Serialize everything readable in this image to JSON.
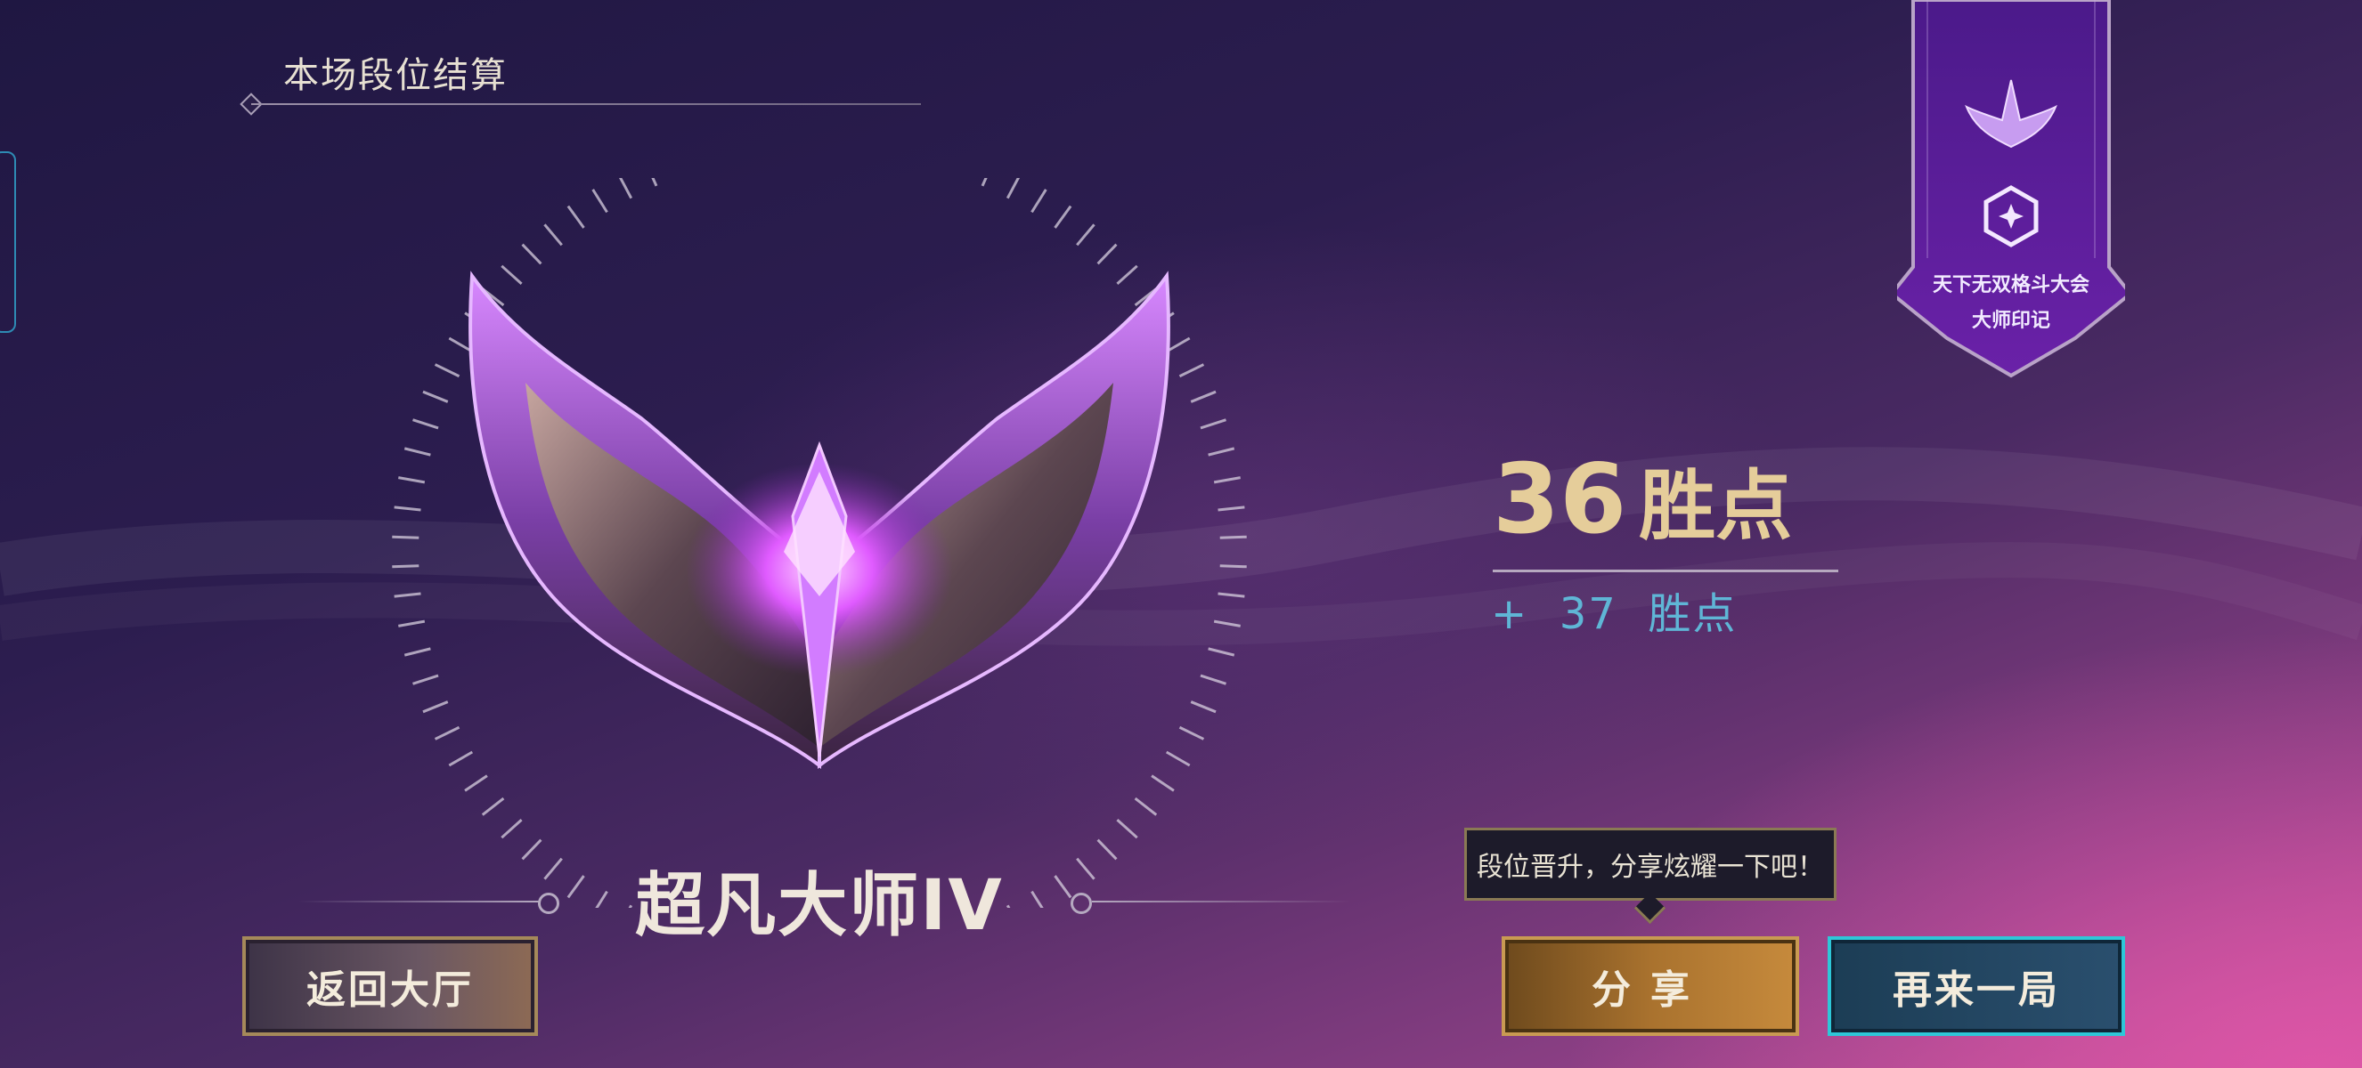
{
  "header": {
    "title": "本场段位结算"
  },
  "rank": {
    "name": "超凡大师IV"
  },
  "points": {
    "value": "36",
    "unit": "胜点",
    "gain": "+  37  胜点"
  },
  "tooltip": {
    "text": "段位晋升，分享炫耀一下吧！"
  },
  "buttons": {
    "back": "返回大厅",
    "share": "分享",
    "again": "再来一局"
  },
  "banner": {
    "line1": "天下无双格斗大会",
    "line2": "大师印记"
  },
  "colors": {
    "gold": "#e5cd9a",
    "accent_blue": "#5fb6d6",
    "emblem_purple": "#b04fe8",
    "again_border": "#2ec7d8"
  },
  "icons": [
    "master-emblem-icon",
    "mini-emblem-icon",
    "hexagon-star-icon"
  ]
}
